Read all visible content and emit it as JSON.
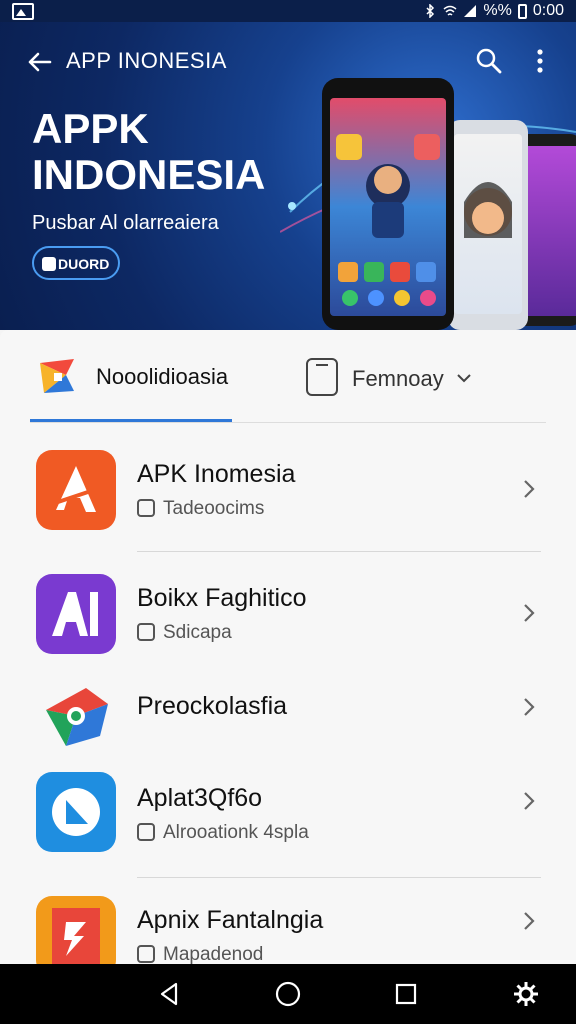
{
  "status_bar": {
    "battery_text": "%%",
    "time": "0:00"
  },
  "header": {
    "title": "APP INONESIA",
    "back_icon": "arrow-left-icon",
    "search_icon": "search-icon",
    "more_icon": "more-vert-icon"
  },
  "hero": {
    "title": "APPK INDONESIA",
    "subtitle": "Pusbar Al olarreaiera",
    "button_label": "DUORD"
  },
  "tabs": [
    {
      "label": "Nooolidioasia",
      "selected": true
    },
    {
      "label": "Femnoay",
      "selected": false
    }
  ],
  "apps": [
    {
      "name": "APK Inomesia",
      "meta": "Tadeoocims",
      "color": "#f05a24"
    },
    {
      "name": "Boikx Faghitico",
      "meta": "Sdicapa",
      "color": "#7a3ad0"
    },
    {
      "name": "Preockolasfia",
      "meta": "",
      "color": "#e8463a"
    },
    {
      "name": "Aplat3Qf6o",
      "meta": "Alrooationk 4spla",
      "color": "#1f8ee0"
    },
    {
      "name": "Apnix Fantalngia",
      "meta": "Mapadenod",
      "color": "#f29a1a"
    }
  ],
  "accent_color": "#2f78d8"
}
